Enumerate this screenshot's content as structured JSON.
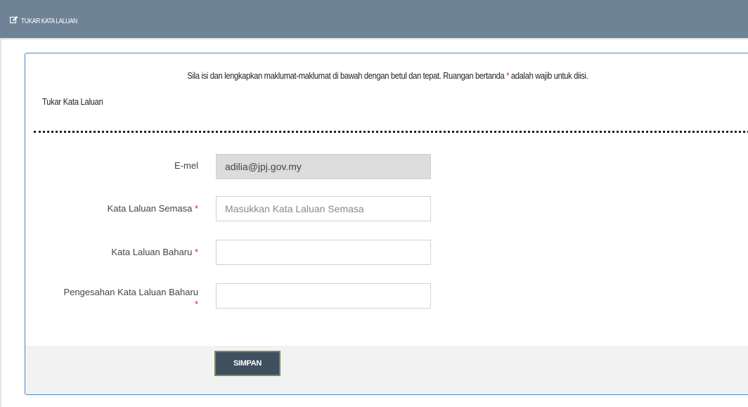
{
  "header": {
    "icon": "edit-icon",
    "title": "TUKAR KATA LALUAN"
  },
  "notice": {
    "before_star": "Sila isi dan lengkapkan maklumat-maklumat di bawah dengan betul dan tepat. Ruangan bertanda ",
    "star": "*",
    "after_star": " adalah wajib untuk diisi."
  },
  "section": {
    "title": "Tukar Kata Laluan"
  },
  "form": {
    "email": {
      "label": "E-mel",
      "value": "adilia@jpj.gov.my"
    },
    "current_password": {
      "label": "Kata Laluan Semasa",
      "required": "*",
      "placeholder": "Masukkan Kata Laluan Semasa"
    },
    "new_password": {
      "label": "Kata Laluan Baharu",
      "required": "*",
      "value": ""
    },
    "confirm_password": {
      "label": "Pengesahan Kata Laluan Baharu",
      "required": "*",
      "value": ""
    }
  },
  "actions": {
    "save_label": "SIMPAN"
  },
  "colors": {
    "header_bg": "#6e8396",
    "card_border": "#4a86c5",
    "required": "#e02424",
    "button_bg": "#3f4f5f"
  }
}
